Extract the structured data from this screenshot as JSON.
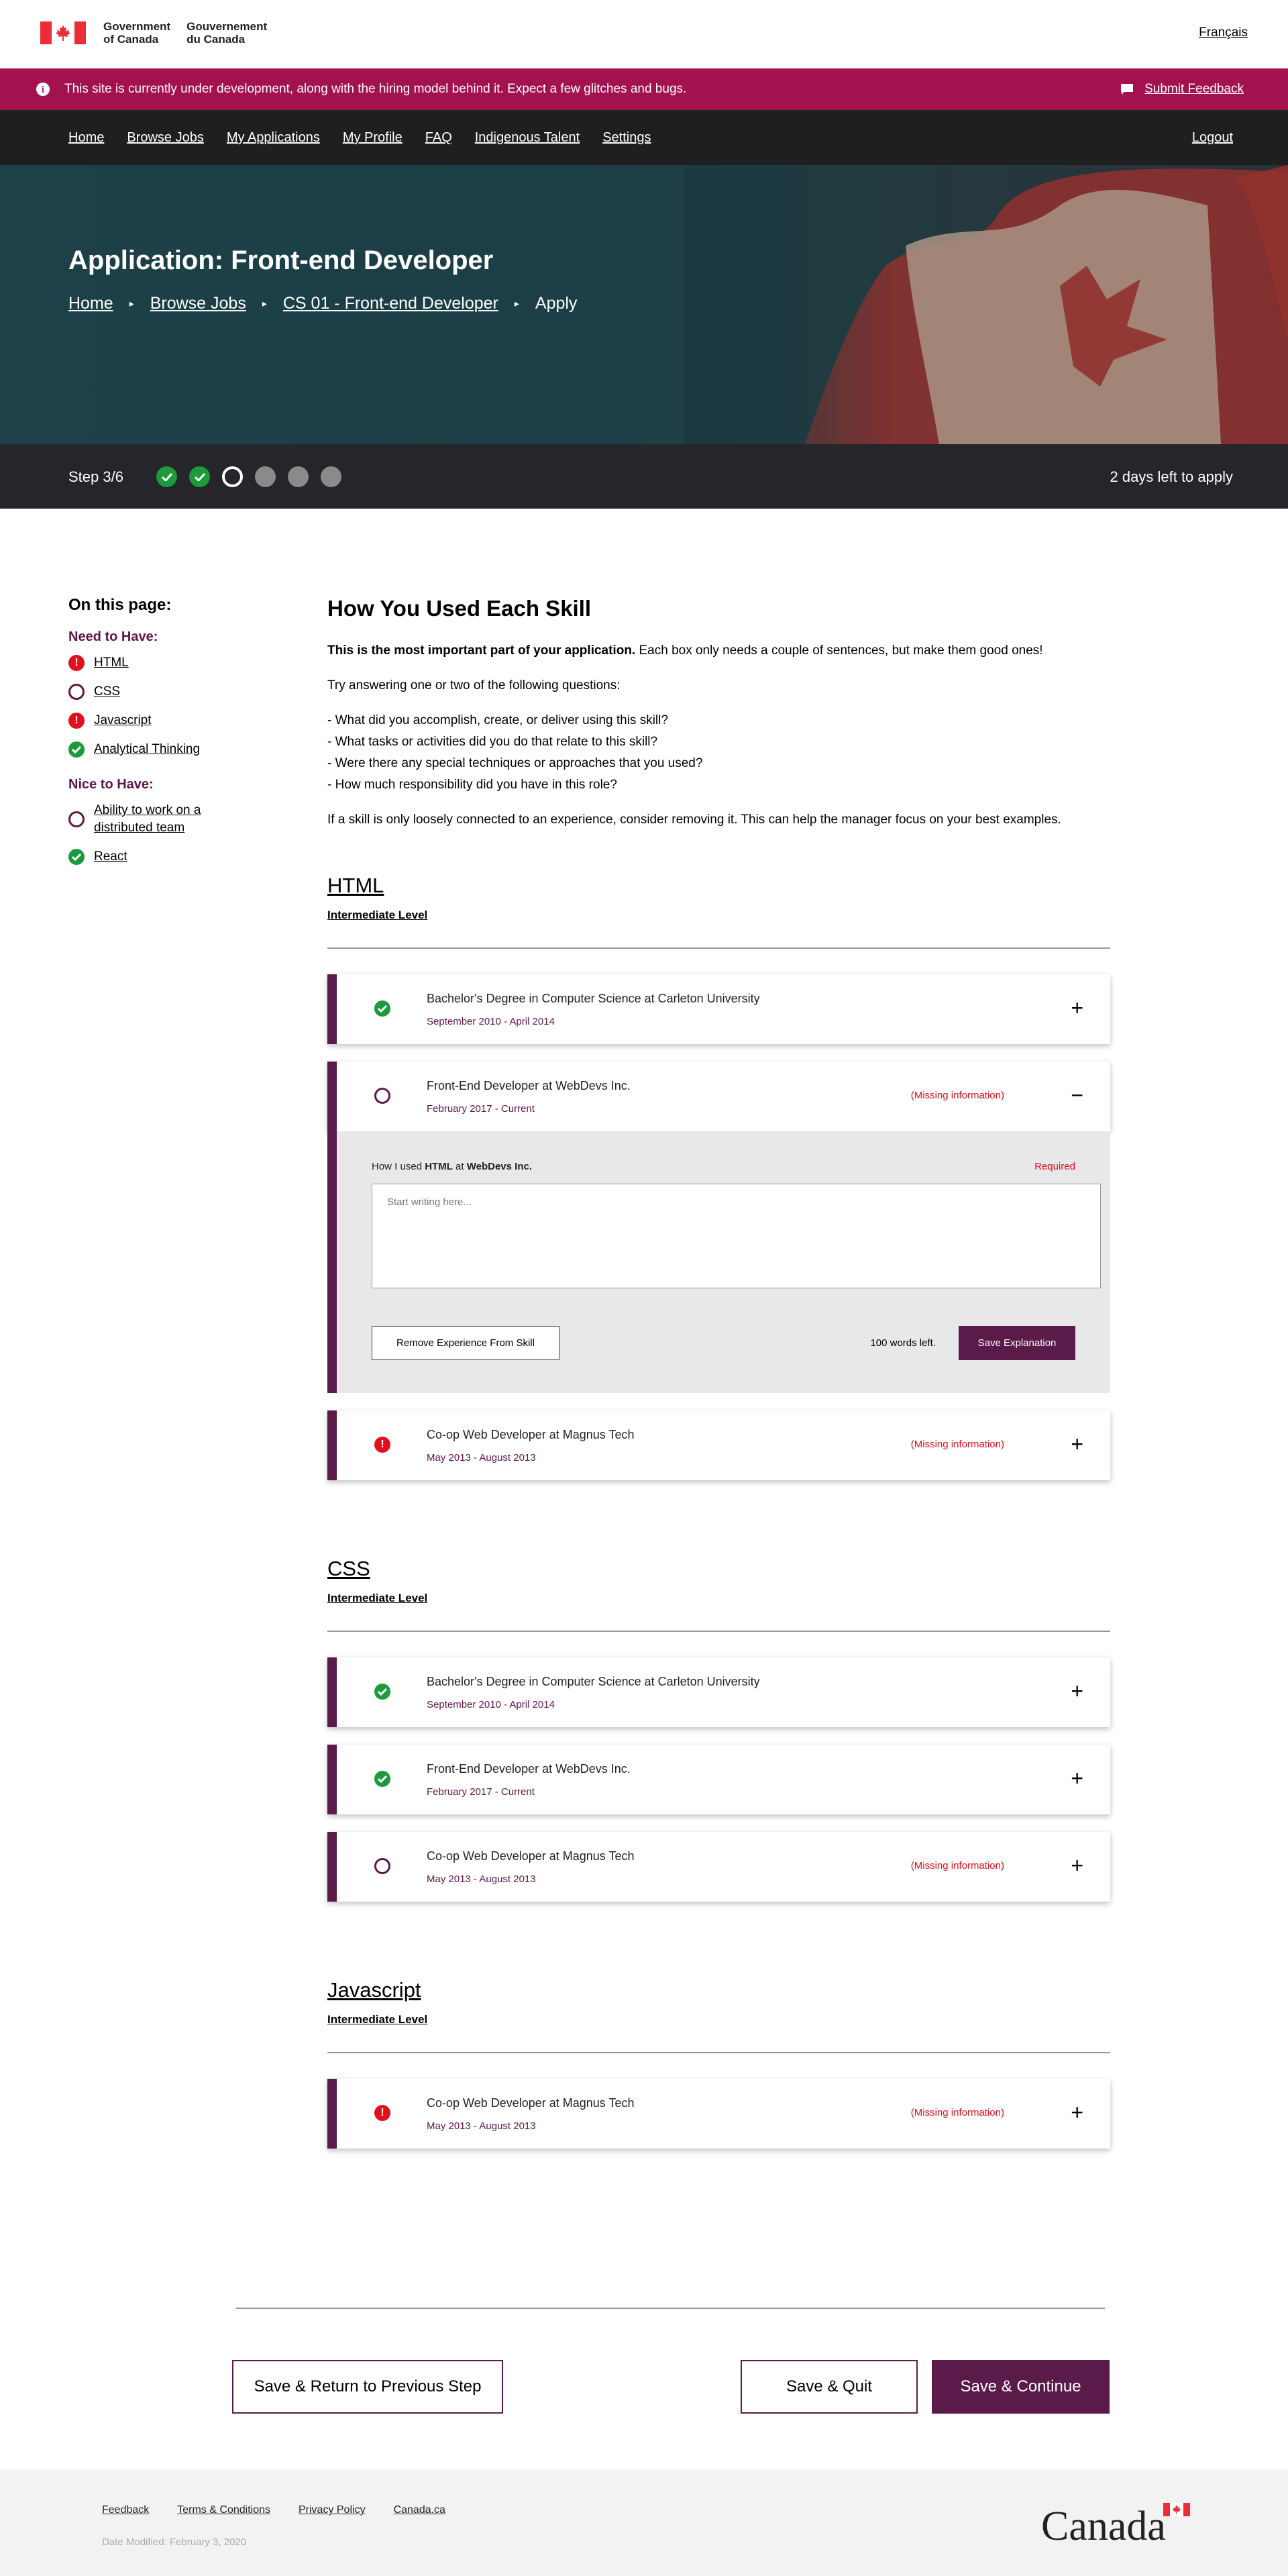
{
  "gov_header": {
    "gov_en": "Government\nof Canada",
    "gov_en_1": "Government",
    "gov_en_2": "of Canada",
    "gov_fr_1": "Gouvernement",
    "gov_fr_2": "du Canada",
    "language_link": "Français"
  },
  "dev_banner": {
    "message": "This site is currently under development, along with the hiring model behind it. Expect a few glitches and bugs.",
    "feedback_label": "Submit Feedback"
  },
  "nav": {
    "items": [
      "Home",
      "Browse Jobs",
      "My Applications",
      "My Profile",
      "FAQ",
      "Indigenous Talent",
      "Settings"
    ],
    "logout": "Logout"
  },
  "hero": {
    "title": "Application: Front-end Developer",
    "breadcrumbs": [
      "Home",
      "Browse Jobs",
      "CS 01 - Front-end Developer",
      "Apply"
    ]
  },
  "steps": {
    "label": "Step 3/6",
    "states": [
      "done",
      "done",
      "current",
      "todo",
      "todo",
      "todo"
    ],
    "deadline": "2 days left to apply"
  },
  "sidebar": {
    "heading": "On this page:",
    "need_heading": "Need to Have:",
    "need_items": [
      {
        "label": "HTML",
        "status": "error"
      },
      {
        "label": "CSS",
        "status": "empty"
      },
      {
        "label": "Javascript",
        "status": "error"
      },
      {
        "label": "Analytical Thinking",
        "status": "complete"
      }
    ],
    "nice_heading": "Nice to Have:",
    "nice_items": [
      {
        "label": "Ability to work on a distributed team",
        "status": "empty"
      },
      {
        "label": "React",
        "status": "complete"
      }
    ]
  },
  "intro": {
    "heading": "How You Used Each Skill",
    "p1_bold": "This is the most important part of your application.",
    "p1_rest": " Each box only needs a couple of sentences, but make them good ones!",
    "p2": "Try answering one or two of the following questions:",
    "questions": [
      "- What did you accomplish, create, or deliver using this skill?",
      "- What tasks or activities did you do that relate to this skill?",
      "- Were there any special techniques or approaches that you used?",
      "- How much responsibility did you have in this role?"
    ],
    "p3": "If a skill is only loosely connected to an experience, consider removing it. This can help the manager focus on your best examples."
  },
  "skills": [
    {
      "name": "HTML",
      "level": "Intermediate Level",
      "experiences": [
        {
          "title": "Bachelor's Degree in Computer Science at Carleton University",
          "dates": "September 2010 -  April 2014",
          "status": "complete",
          "missing": "",
          "toggle": "+"
        },
        {
          "title": "Front-End Developer at WebDevs Inc.",
          "dates": "February 2017 - Current",
          "status": "empty",
          "missing": "(Missing information)",
          "toggle": "−"
        },
        {
          "title": "Co-op Web Developer at Magnus Tech",
          "dates": "May 2013 - August 2013",
          "status": "error",
          "missing": "(Missing information)",
          "toggle": "+"
        }
      ]
    },
    {
      "name": "CSS",
      "level": "Intermediate Level",
      "experiences": [
        {
          "title": "Bachelor's Degree in Computer Science at Carleton University",
          "dates": "September 2010 -  April 2014",
          "status": "complete",
          "missing": "",
          "toggle": "+"
        },
        {
          "title": "Front-End Developer at WebDevs Inc.",
          "dates": "February 2017 - Current",
          "status": "complete",
          "missing": "",
          "toggle": "+"
        },
        {
          "title": "Co-op Web Developer at Magnus Tech",
          "dates": "May 2013 - August 2013",
          "status": "empty",
          "missing": "(Missing information)",
          "toggle": "+"
        }
      ]
    },
    {
      "name": "Javascript",
      "level": "Intermediate Level",
      "experiences": [
        {
          "title": "Co-op Web Developer at Magnus Tech",
          "dates": "May 2013 - August 2013",
          "status": "error",
          "missing": "(Missing information)",
          "toggle": "+"
        }
      ]
    }
  ],
  "explanation_panel": {
    "label_prefix": "How I used ",
    "label_skill": "HTML",
    "label_mid": " at ",
    "label_org": "WebDevs Inc.",
    "required": "Required",
    "placeholder": "Start writing here...",
    "remove_button": "Remove Experience From Skill",
    "words_left": "100 words left.",
    "save_button": "Save Explanation"
  },
  "actions": {
    "prev": "Save & Return to Previous Step",
    "quit": "Save & Quit",
    "continue": "Save & Continue"
  },
  "footer": {
    "links": [
      "Feedback",
      "Terms & Conditions ",
      "Privacy Policy",
      "Canada.ca"
    ],
    "modified": "Date Modified: February 3, 2020",
    "wordmark": "Canada"
  },
  "colors": {
    "brand_purple": "#5a1a4a",
    "banner_magenta": "#a3114f",
    "success": "#1c9a3c",
    "error": "#e20f1d"
  }
}
